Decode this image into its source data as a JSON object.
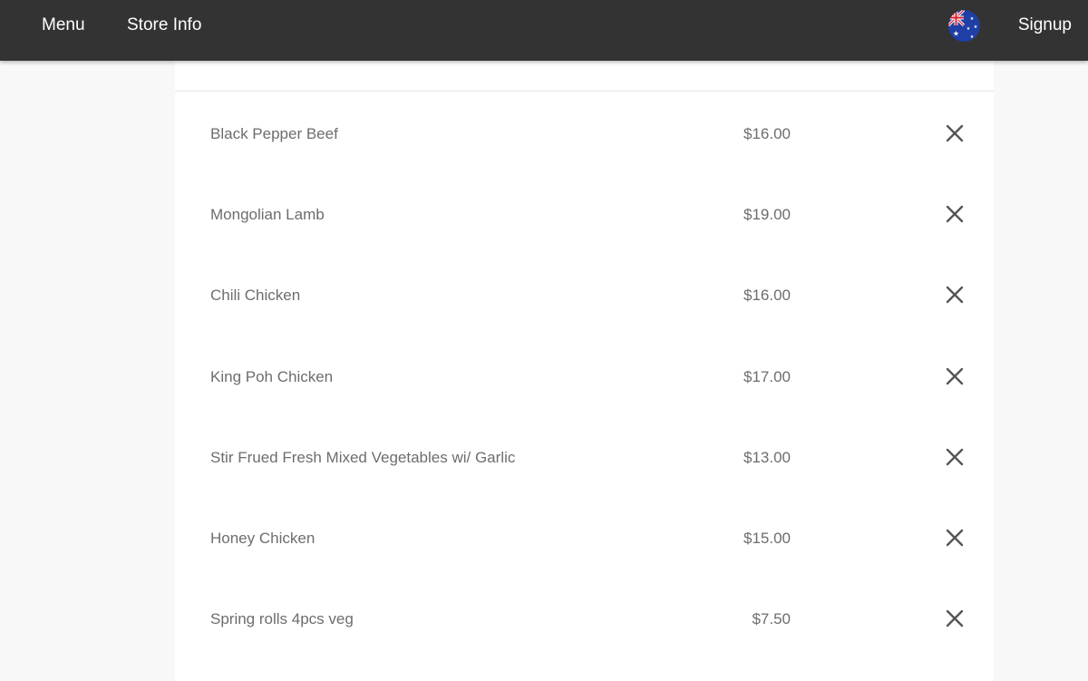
{
  "nav": {
    "menu_label": "Menu",
    "store_info_label": "Store Info",
    "signup_label": "Signup",
    "flag_icon": "australia-flag-icon"
  },
  "cart": {
    "items": [
      {
        "name": "Black Pepper Beef",
        "price": "$16.00"
      },
      {
        "name": "Mongolian Lamb",
        "price": "$19.00"
      },
      {
        "name": "Chili Chicken",
        "price": "$16.00"
      },
      {
        "name": "King Poh Chicken",
        "price": "$17.00"
      },
      {
        "name": "Stir Frued Fresh Mixed Vegetables wi/ Garlic",
        "price": "$13.00"
      },
      {
        "name": "Honey Chicken",
        "price": "$15.00"
      },
      {
        "name": "Spring rolls 4pcs veg",
        "price": "$7.50"
      }
    ],
    "remove_icon": "close-icon"
  },
  "colors": {
    "topbar": "#333333",
    "page_background": "#f8f8f8",
    "panel": "#ffffff",
    "item_text": "#6d6d6d"
  }
}
